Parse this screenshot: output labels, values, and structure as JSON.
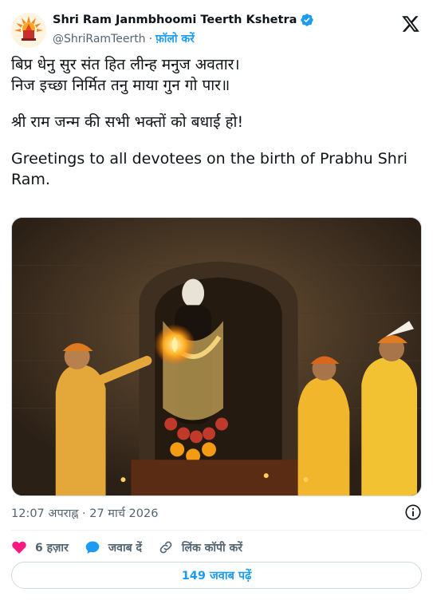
{
  "author": {
    "display_name": "Shri Ram Janmbhoomi Teerth Kshetra",
    "handle": "@ShriRamTeerth",
    "separator": "·",
    "follow_label": "फ़ॉलो करें",
    "verified_color": "#1d9bf0"
  },
  "tweet": {
    "line1": "बिप्र धेनु सुर संत हित लीन्ह मनुज अवतार।\nनिज इच्छा निर्मित तनु माया गुन गो पार॥",
    "line2": "श्री राम जन्म की सभी भक्तों को बधाई हो!",
    "line3": "Greetings to all devotees on the birth of Prabhu Shri Ram.",
    "timestamp": "12:07 अपराह्न · 27 मार्च 2026"
  },
  "actions": {
    "likes": "6 हज़ार",
    "reply_label": "जवाब दें",
    "copy_link_label": "लिंक कॉपी करें",
    "read_replies_label": "149 जवाब पढ़ें"
  },
  "icons": {
    "logo": "x-logo-icon",
    "like": "heart-icon",
    "reply": "reply-bubble-icon",
    "copy_link": "link-icon",
    "info": "info-icon"
  },
  "colors": {
    "accent": "#1d9bf0",
    "heart": "#f91880",
    "text": "#0f1419",
    "secondary": "#536471"
  }
}
